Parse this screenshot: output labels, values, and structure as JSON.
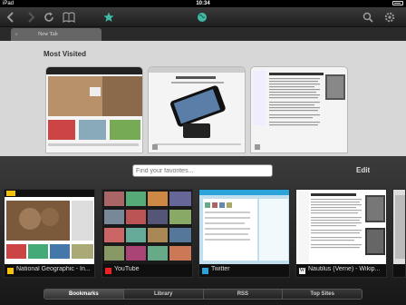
{
  "status": {
    "carrier": "iPad",
    "time": "10:34"
  },
  "tab": {
    "title": "New Tab",
    "close": "×"
  },
  "main": {
    "heading": "Most Visited"
  },
  "favorites": {
    "search_placeholder": "Find your favorites...",
    "edit_label": "Edit",
    "cards": [
      {
        "label": "National Geographic - In..."
      },
      {
        "label": "YouTube"
      },
      {
        "label": "Twitter"
      },
      {
        "label": "Nautilus (Verne) - Wikip..."
      }
    ]
  },
  "segments": [
    "Bookmarks",
    "Library",
    "RSS",
    "Top Sites"
  ],
  "colors": {
    "accent": "#3fb8a4",
    "panel": "#2b2b2b",
    "page": "#d7d7d7"
  }
}
